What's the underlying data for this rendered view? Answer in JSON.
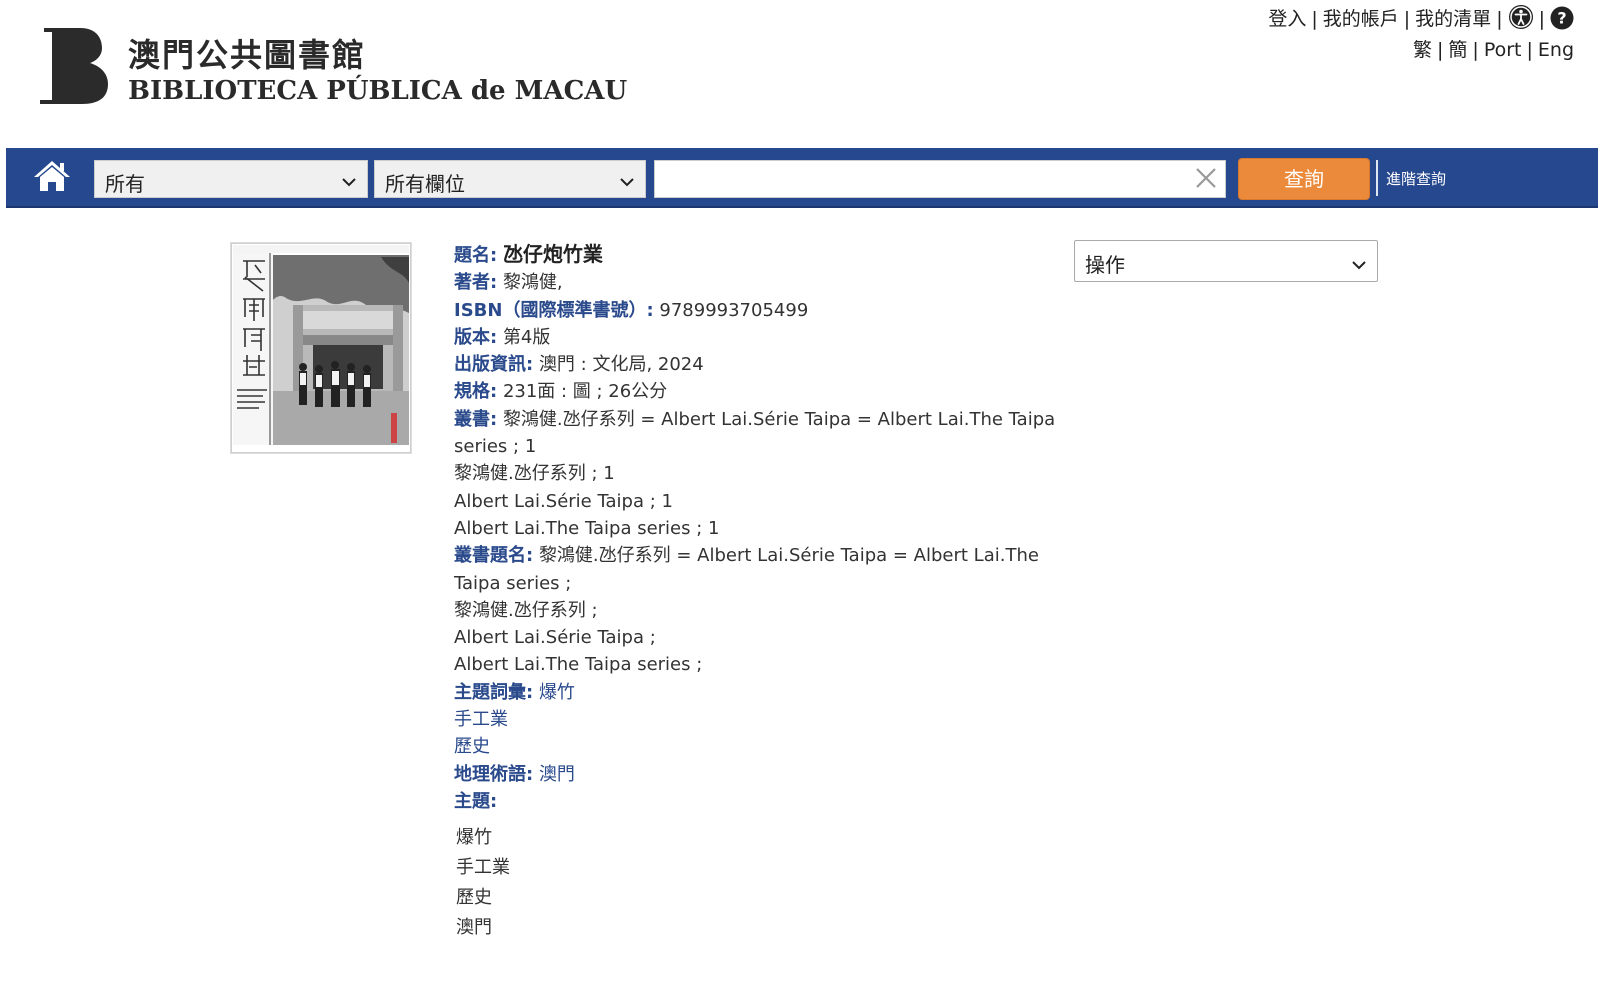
{
  "header": {
    "logo_zh": "澳門公共圖書館",
    "logo_pt": "BIBLIOTECA PÚBLICA de MACAU",
    "links": {
      "login": "登入",
      "account": "我的帳戶",
      "list": "我的清單",
      "sep": "|",
      "trad": "繁",
      "simp": "簡",
      "port": "Port",
      "eng": "Eng"
    }
  },
  "search": {
    "scope": "所有",
    "field": "所有欄位",
    "query": "",
    "submit": "查詢",
    "advanced": "進階查詢"
  },
  "record": {
    "title_label": "題名:",
    "title": "氹仔炮竹業",
    "author_label": "著者:",
    "author": "黎鴻健,",
    "isbn_label": "ISBN（國際標準書號）:",
    "isbn": "9789993705499",
    "edition_label": "版本:",
    "edition": "第4版",
    "pub_label": "出版資訊:",
    "pub": "澳門 : 文化局, 2024",
    "desc_label": "規格:",
    "desc": "231面 : 圖 ; 26公分",
    "series_label": "叢書:",
    "series_first": "黎鴻健.氹仔系列 = Albert Lai.Série Taipa = Albert Lai.The Taipa series ; 1",
    "series_lines": [
      "黎鴻健.氹仔系列 ; 1",
      "Albert Lai.Série Taipa ; 1",
      "Albert Lai.The Taipa series ; 1"
    ],
    "series_title_label": "叢書題名:",
    "series_title_first": "黎鴻健.氹仔系列 = Albert Lai.Série Taipa = Albert Lai.The Taipa series ;",
    "series_title_lines": [
      "黎鴻健.氹仔系列 ;",
      "Albert Lai.Série Taipa ;",
      "Albert Lai.The Taipa series ;"
    ],
    "subject_terms_label": "主題詞彙:",
    "subject_terms": [
      "爆竹",
      "手工業",
      "歷史"
    ],
    "geo_label": "地理術語:",
    "geo": "澳門",
    "subjects_label": "主題:",
    "subjects": [
      "爆竹",
      "手工業",
      "歷史",
      "澳門"
    ]
  },
  "actions": {
    "label": "操作"
  }
}
